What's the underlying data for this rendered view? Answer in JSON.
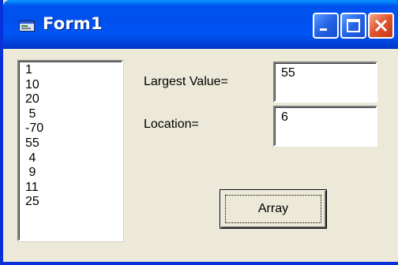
{
  "window": {
    "title": "Form1",
    "icon": "form-icon",
    "controls": [
      "minimize-icon",
      "maximize-icon",
      "close-icon"
    ],
    "accent": "#0053ee",
    "close_color": "#e0522b"
  },
  "listbox": {
    "items": [
      "1",
      "10",
      "20",
      " 5",
      "-70",
      "55",
      " 4",
      " 9",
      "11",
      "25"
    ]
  },
  "labels": {
    "largest": "Largest Value=",
    "location": "Location="
  },
  "textboxes": {
    "largest_value": "55",
    "location_value": "6"
  },
  "button": {
    "label": "Array"
  }
}
